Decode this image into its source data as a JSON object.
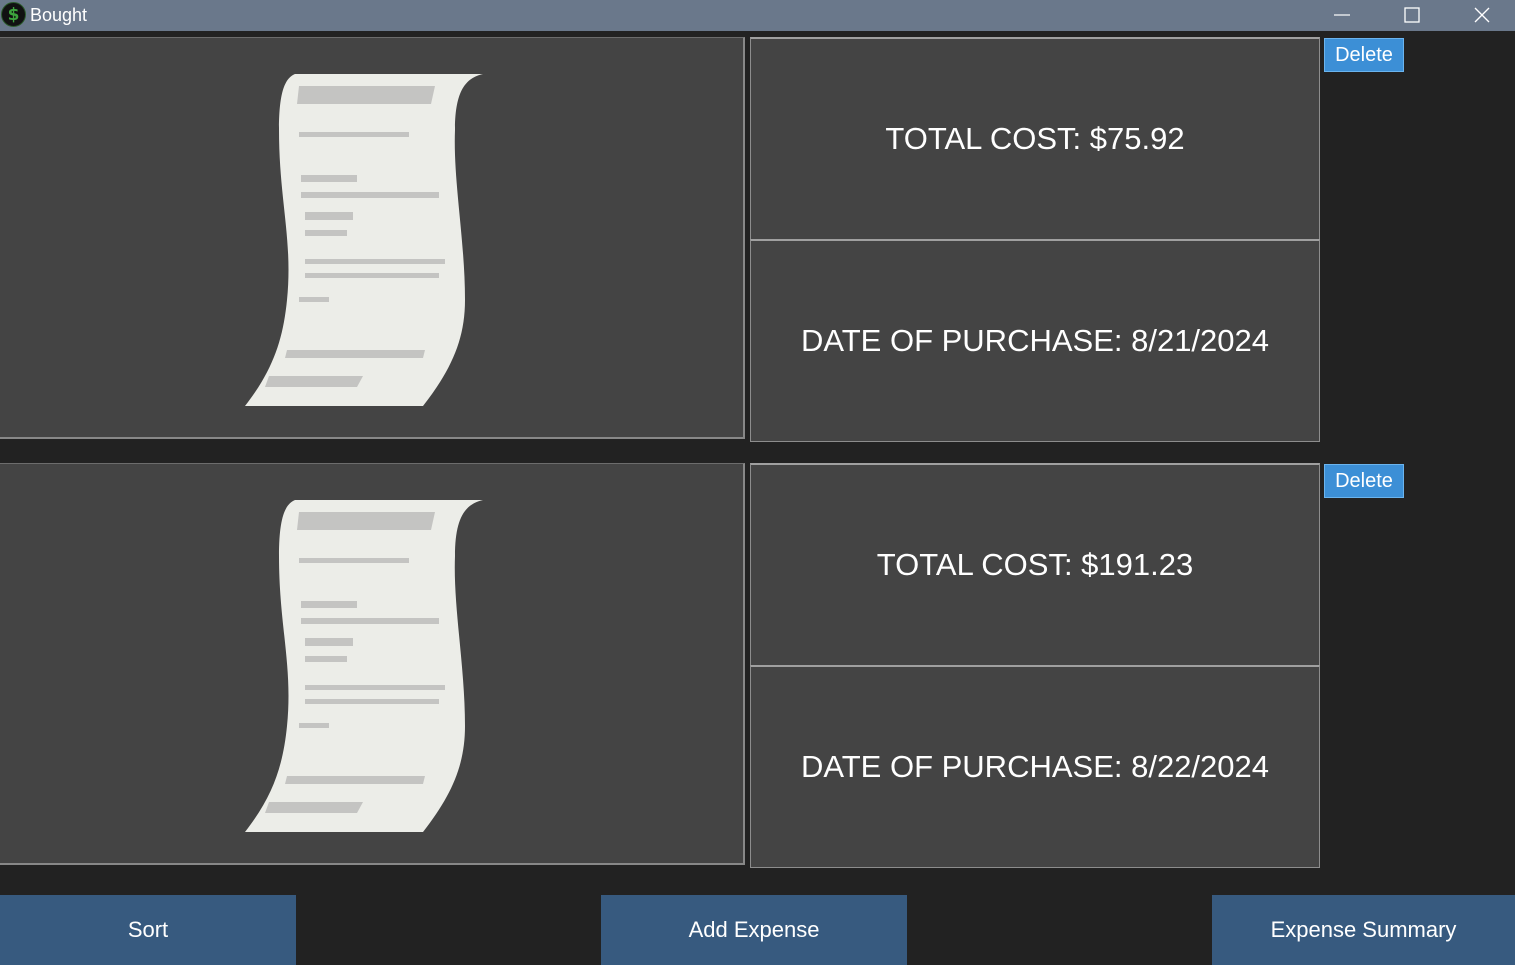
{
  "window": {
    "title": "Bought",
    "icon": "dollar-coin-icon",
    "icon_glyph": "$"
  },
  "expenses": [
    {
      "total_cost": "TOTAL COST: $75.92",
      "date_of_purchase": "DATE OF PURCHASE: 8/21/2024",
      "delete_label": "Delete",
      "image": "receipt-icon"
    },
    {
      "total_cost": "TOTAL COST: $191.23",
      "date_of_purchase": "DATE OF PURCHASE: 8/22/2024",
      "delete_label": "Delete",
      "image": "receipt-icon"
    }
  ],
  "footer": {
    "sort_label": "Sort",
    "add_expense_label": "Add Expense",
    "summary_label": "Expense Summary"
  },
  "colors": {
    "background": "#222222",
    "titlebar": "#6a788b",
    "panel": "#444444",
    "delete_button": "#3c8fd6",
    "footer_button": "#375a7f"
  }
}
